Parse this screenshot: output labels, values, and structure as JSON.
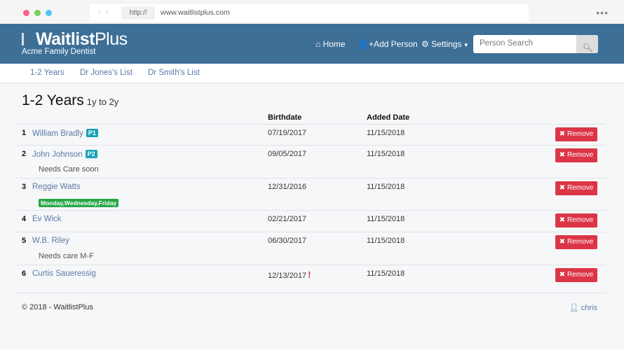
{
  "browser": {
    "protocol": "http://",
    "url": "www.waitlistplus.com",
    "colors": {
      "close": "#ff5f8a",
      "min": "#7dce5a",
      "max": "#4fc3f7"
    }
  },
  "header": {
    "logo_bold": "Waitlist",
    "logo_light": "Plus",
    "subtitle": "Acme Family Dentist",
    "nav": {
      "home": "Home",
      "add_person": "Add Person",
      "settings": "Settings"
    },
    "search_placeholder": "Person Search"
  },
  "subnav": [
    "1-2 Years",
    "Dr Jones's List",
    "Dr Smith's List"
  ],
  "list": {
    "title": "1-2 Years",
    "subtitle": "1y to 2y",
    "col_birthdate": "Birthdate",
    "col_added": "Added Date",
    "remove_label": "Remove",
    "rows": [
      {
        "num": "1",
        "name": "William Bradly",
        "badge": "P1",
        "birthdate": "07/19/2017",
        "added": "11/15/2018"
      },
      {
        "num": "2",
        "name": "John Johnson",
        "badge": "P2",
        "note": "Needs Care soon",
        "birthdate": "09/05/2017",
        "added": "11/15/2018"
      },
      {
        "num": "3",
        "name": "Reggie Watts",
        "tag": "Monday,Wednesday,Friday",
        "birthdate": "12/31/2016",
        "added": "11/15/2018"
      },
      {
        "num": "4",
        "name": "Ev Wick",
        "birthdate": "02/21/2017",
        "added": "11/15/2018"
      },
      {
        "num": "5",
        "name": "W.B. Riley",
        "note": "Needs care M-F",
        "birthdate": "06/30/2017",
        "added": "11/15/2018"
      },
      {
        "num": "6",
        "name": "Curtis Saueressig",
        "warning": "!",
        "birthdate": "12/13/2017",
        "added": "11/15/2018"
      }
    ]
  },
  "footer": {
    "copyright": "© 2018 - WaitlistPlus",
    "user": "chris"
  }
}
